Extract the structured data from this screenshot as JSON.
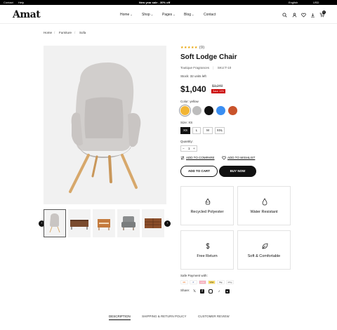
{
  "topbar": {
    "contact": "Contact",
    "help": "Help",
    "promo": "New year sale - 30% off",
    "language": "English",
    "currency": "USD"
  },
  "header": {
    "logo": "Amat",
    "nav": [
      "Home",
      "Shop",
      "Pages",
      "Blog",
      "Contact"
    ],
    "cart_count": "0"
  },
  "breadcrumb": [
    "Home",
    "Furniture",
    "Sofa"
  ],
  "product": {
    "rating_stars": "★★★★★",
    "rating_count": "(9)",
    "title": "Soft Lodge Chair",
    "brand": "Toutique Fragrances",
    "sku": "SKU:T-10",
    "stock": "Stock: 32 units left",
    "price": "$1,040",
    "old_price": "$1,240",
    "badge": "Save 10%",
    "color_label": "Color: yellow",
    "colors": [
      "#f2b533",
      "#bdbdbd",
      "#111111",
      "#3a8ef2",
      "#c9532b"
    ],
    "size_label": "Size: XS",
    "sizes": [
      "XS",
      "L",
      "M",
      "XXL"
    ],
    "quantity_label": "Quantity:",
    "quantity": "1",
    "compare": "ADD TO COMPARE",
    "wishlist": "ADD TO WISHLIST",
    "add_to_cart": "ADD TO CART",
    "buy_now": "BUY NOW"
  },
  "features": [
    "Recycled Polyester",
    "Water Resistant",
    "Free Return",
    "Soft & Comfortable"
  ],
  "payment": {
    "label": "Safe Payment with:",
    "methods": [
      "MC",
      "P",
      "AMEX",
      "VISA",
      "Pay",
      "GPay"
    ]
  },
  "share": {
    "label": "Share:"
  },
  "tabs": [
    "DESCRIPTION",
    "SHIPPING & RETURN POLICY",
    "CUSTOMER REVIEW"
  ]
}
